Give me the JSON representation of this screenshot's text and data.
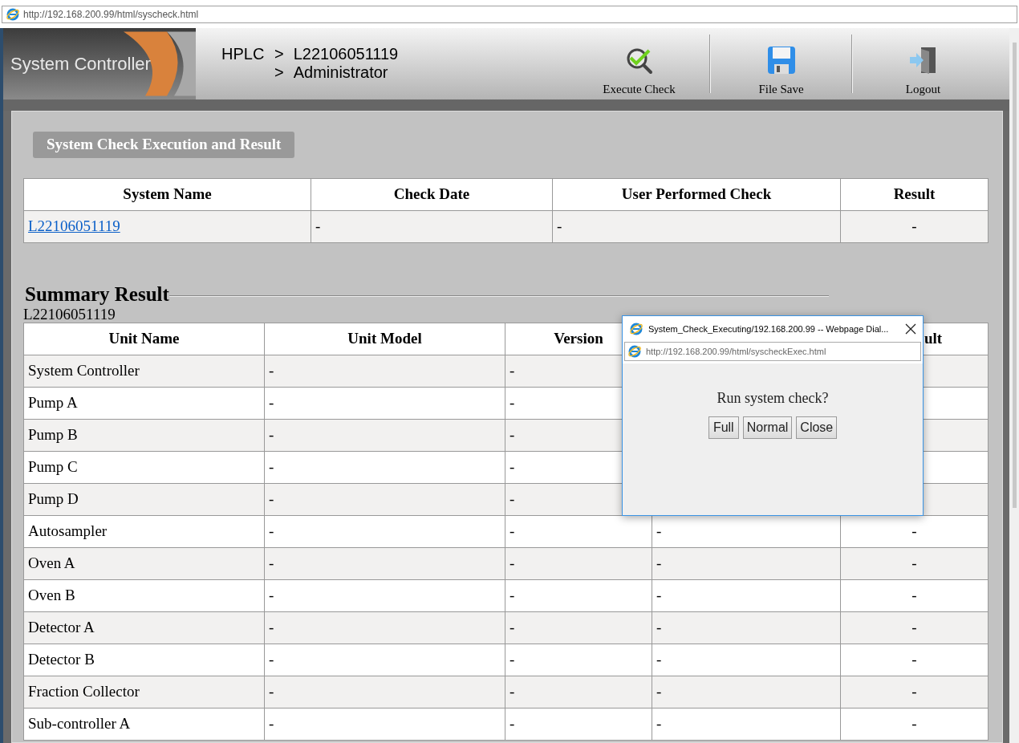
{
  "browser": {
    "url": "http://192.168.200.99/html/syscheck.html"
  },
  "header": {
    "logo": "System Controller",
    "root": "HPLC",
    "levels": [
      {
        "separator": ">",
        "label": "L22106051119"
      },
      {
        "separator": ">",
        "label": "Administrator"
      }
    ]
  },
  "toolbar": [
    {
      "kind": "execute",
      "label": "Execute Check"
    },
    {
      "kind": "save",
      "label": "File Save"
    },
    {
      "kind": "logout",
      "label": "Logout"
    }
  ],
  "section_title": "System Check Execution and Result",
  "check_table": {
    "columns": [
      "System Name",
      "Check Date",
      "User Performed Check",
      "Result"
    ],
    "rows": [
      {
        "cells": [
          {
            "text": "L22106051119",
            "kind": "link"
          },
          {
            "text": "-",
            "kind": "text"
          },
          {
            "text": "-",
            "kind": "text"
          },
          {
            "text": "-",
            "kind": "text"
          }
        ]
      }
    ]
  },
  "summary": {
    "title": "Summary Result",
    "system": "L22106051119",
    "columns": [
      "Unit Name",
      "Unit Model",
      "Version"
    ],
    "column_5": "ult",
    "rows": [
      {
        "cells": [
          "System Controller",
          "-",
          "-"
        ]
      },
      {
        "cells": [
          "Pump A",
          "-",
          "-"
        ]
      },
      {
        "cells": [
          "Pump B",
          "-",
          "-"
        ]
      },
      {
        "cells": [
          "Pump C",
          "-",
          "-"
        ]
      },
      {
        "cells": [
          "Pump D",
          "-",
          "-"
        ]
      },
      {
        "cells": [
          "Autosampler",
          "-",
          "-",
          "-",
          "-"
        ]
      },
      {
        "cells": [
          "Oven A",
          "-",
          "-",
          "-",
          "-"
        ]
      },
      {
        "cells": [
          "Oven B",
          "-",
          "-",
          "-",
          "-"
        ]
      },
      {
        "cells": [
          "Detector A",
          "-",
          "-",
          "-",
          "-"
        ]
      },
      {
        "cells": [
          "Detector B",
          "-",
          "-",
          "-",
          "-"
        ]
      },
      {
        "cells": [
          "Fraction Collector",
          "-",
          "-",
          "-",
          "-"
        ]
      },
      {
        "cells": [
          "Sub-controller A",
          "-",
          "-",
          "-",
          "-"
        ]
      }
    ]
  },
  "dialog": {
    "title": "System_Check_Executing/192.168.200.99 -- Webpage Dial...",
    "url": "http://192.168.200.99/html/syscheckExec.html",
    "message": "Run system check?",
    "buttons": [
      "Full",
      "Normal",
      "Close"
    ]
  }
}
